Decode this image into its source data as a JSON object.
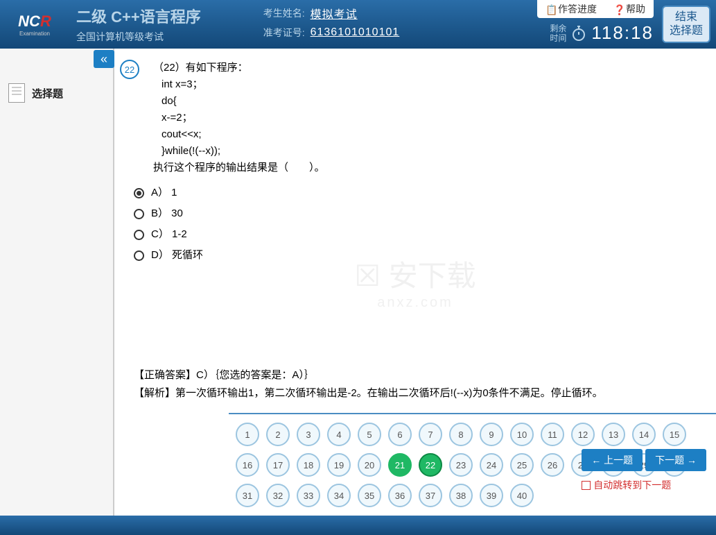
{
  "header": {
    "logo_main": "NCR",
    "logo_sub": "Examination",
    "title": "二级  C++语言程序",
    "subtitle": "全国计算机等级考试",
    "name_label": "考生姓名:",
    "name_value": "模拟考试",
    "id_label": "准考证号:",
    "id_value": "6136101010101",
    "tab_progress": "作答进度",
    "tab_help": "帮助",
    "timer_label_1": "剩余",
    "timer_label_2": "时间",
    "timer_value": "118:18",
    "end_btn_1": "结束",
    "end_btn_2": "选择题"
  },
  "sidebar": {
    "item_label": "选择题"
  },
  "question": {
    "number": "22",
    "prefix": "（22）有如下程序：",
    "code_line_1": "int x=3；",
    "code_line_2": "do{",
    "code_line_3": "x-=2；",
    "code_line_4": "cout<<x;",
    "code_line_5": "}while(!(--x));",
    "stem_end": "执行这个程序的输出结果是（　　）。",
    "opt_a": "A） 1",
    "opt_b": "B） 30",
    "opt_c": "C） 1-2",
    "opt_d": "D） 死循环",
    "selected": "A"
  },
  "answer": {
    "correct_line": "【正确答案】C）｛您选的答案是：A）｝",
    "explain_line": "【解析】第一次循环输出1，第二次循环输出是-2。在输出二次循环后!(--x)为0条件不满足。停止循环。"
  },
  "nav": {
    "total": 40,
    "active": [
      21,
      22
    ],
    "current": 22,
    "prev_label": "← 上一题",
    "next_label": "下一题 →",
    "auto_next_label": "自动跳转到下一题"
  },
  "watermark": {
    "main": "☒ 安下载",
    "sub": "anxz.com"
  }
}
